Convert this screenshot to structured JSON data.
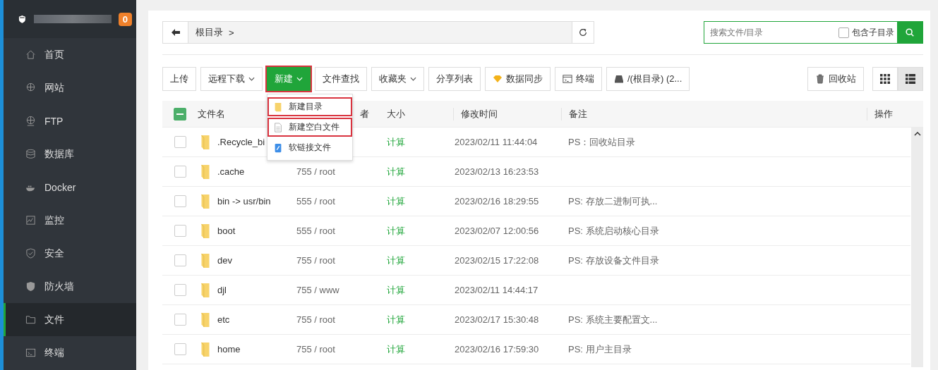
{
  "sidebar": {
    "badge": "0",
    "items": [
      {
        "label": "首页",
        "selected": false
      },
      {
        "label": "网站",
        "selected": false
      },
      {
        "label": "FTP",
        "selected": false
      },
      {
        "label": "数据库",
        "selected": false
      },
      {
        "label": "Docker",
        "selected": false
      },
      {
        "label": "监控",
        "selected": false
      },
      {
        "label": "安全",
        "selected": false
      },
      {
        "label": "防火墙",
        "selected": false
      },
      {
        "label": "文件",
        "selected": true
      },
      {
        "label": "终端",
        "selected": false
      }
    ]
  },
  "breadcrumb": {
    "path": "根目录",
    "separator": ">"
  },
  "search": {
    "placeholder": "搜索文件/目录",
    "include_subdirs": {
      "label": "包含子目录",
      "checked": false
    }
  },
  "toolbar": {
    "buttons": [
      {
        "label": "上传",
        "kind": "plain",
        "highlighted": false
      },
      {
        "label": "远程下载",
        "kind": "dropdown",
        "highlighted": false
      },
      {
        "label": "新建",
        "kind": "primary",
        "highlighted": true
      },
      {
        "label": "文件查找",
        "kind": "plain",
        "highlighted": false
      },
      {
        "label": "收藏夹",
        "kind": "dropdown",
        "highlighted": false
      },
      {
        "label": "分享列表",
        "kind": "plain",
        "highlighted": false
      },
      {
        "label": "数据同步",
        "kind": "gem",
        "highlighted": false
      },
      {
        "label": "终端",
        "kind": "terminal",
        "highlighted": false
      },
      {
        "label": "/(根目录) (2...",
        "kind": "disk",
        "highlighted": false
      }
    ],
    "recycle": "回收站",
    "views": [
      {
        "kind": "grid",
        "selected": false
      },
      {
        "kind": "list",
        "selected": true
      }
    ]
  },
  "new_menu": [
    {
      "label": "新建目录",
      "kind": "folder",
      "highlighted": true
    },
    {
      "label": "新建空白文件",
      "kind": "file",
      "highlighted": true
    },
    {
      "label": "软链接文件",
      "kind": "link",
      "highlighted": false
    }
  ],
  "table": {
    "select_all": {
      "indeterminate": true
    },
    "columns": [
      "文件名",
      "者",
      "大小",
      "修改时间",
      "备注",
      "操作"
    ],
    "rows": [
      {
        "name": ".Recycle_bi",
        "perm": "",
        "size": "计算",
        "modified": "2023/02/11 11:44:04",
        "note": "PS：回收站目录",
        "checked": false
      },
      {
        "name": ".cache",
        "perm": "755 / root",
        "size": "计算",
        "modified": "2023/02/13 16:23:53",
        "note": "",
        "checked": false
      },
      {
        "name": "bin -> usr/bin",
        "perm": "555 / root",
        "size": "计算",
        "modified": "2023/02/16 18:29:55",
        "note": "PS: 存放二进制可执...",
        "checked": false
      },
      {
        "name": "boot",
        "perm": "555 / root",
        "size": "计算",
        "modified": "2023/02/07 12:00:56",
        "note": "PS: 系统启动核心目录",
        "checked": false
      },
      {
        "name": "dev",
        "perm": "755 / root",
        "size": "计算",
        "modified": "2023/02/15 17:22:08",
        "note": "PS: 存放设备文件目录",
        "checked": false
      },
      {
        "name": "djl",
        "perm": "755 / www",
        "size": "计算",
        "modified": "2023/02/11 14:44:17",
        "note": "",
        "checked": false
      },
      {
        "name": "etc",
        "perm": "755 / root",
        "size": "计算",
        "modified": "2023/02/17 15:30:48",
        "note": "PS: 系统主要配置文...",
        "checked": false
      },
      {
        "name": "home",
        "perm": "755 / root",
        "size": "计算",
        "modified": "2023/02/16 17:59:30",
        "note": "PS: 用户主目录",
        "checked": false
      }
    ]
  }
}
